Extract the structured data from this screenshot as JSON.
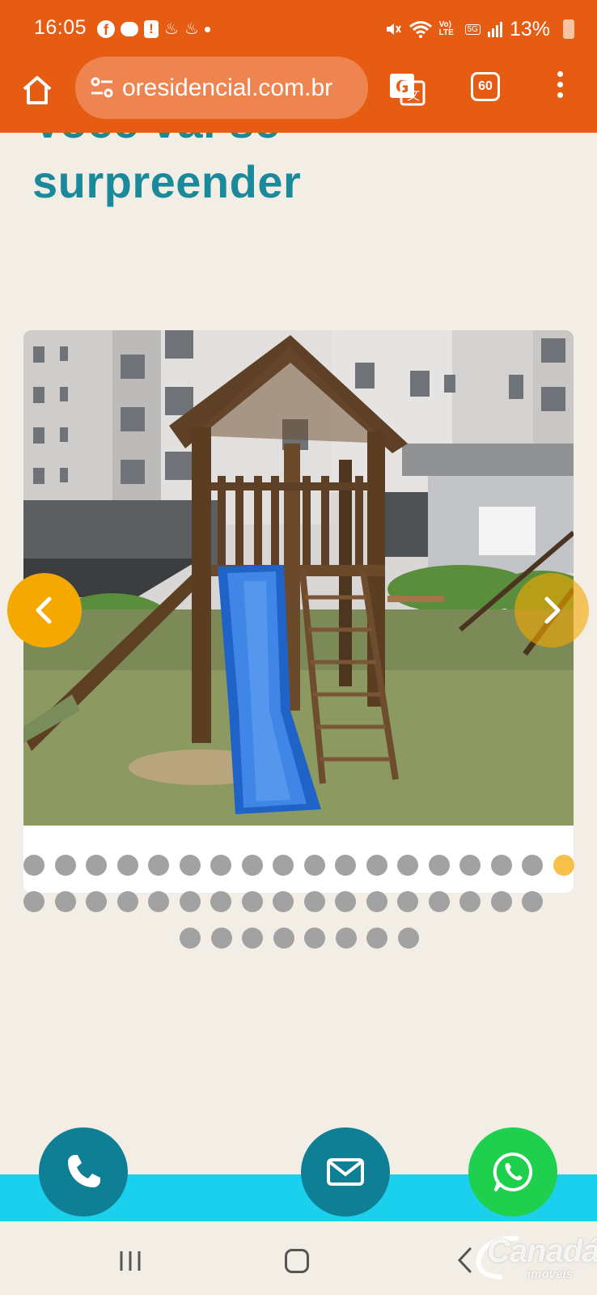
{
  "status_bar": {
    "time": "16:05",
    "battery": "13%",
    "network": "5G",
    "volte": "Vo) LTE",
    "notification_icons": [
      "facebook-icon",
      "messenger-icon",
      "alert-icon",
      "santander-icon",
      "santander-icon",
      "dot-icon"
    ],
    "system_icons": [
      "mute-icon",
      "wifi-icon",
      "volte-icon",
      "5g-icon",
      "signal-icon",
      "battery-icon"
    ]
  },
  "browser": {
    "url": "oresidencial.com.br",
    "tab_count": "60",
    "icons": [
      "home-icon",
      "site-settings-icon",
      "translate-icon",
      "tabs-icon",
      "menu-icon"
    ]
  },
  "page": {
    "heading_partial": "Você vai se",
    "heading": "surpreender"
  },
  "carousel": {
    "image_subject": "wooden playground with blue slide in front of apartment buildings",
    "total_slides": 43,
    "active_index": 17,
    "prev_icon": "chevron-left-icon",
    "next_icon": "chevron-right-icon"
  },
  "contact_buttons": [
    "phone-icon",
    "mail-icon",
    "whatsapp-icon"
  ],
  "watermark": {
    "name": "Canadá",
    "sub": "imóveis"
  },
  "colors": {
    "header_orange": "#e65c13",
    "heading_teal": "#1a8a9b",
    "arrow_gold": "#f5a800",
    "active_dot": "#f7c04a",
    "inactive_dot": "#a2a2a2",
    "cyan_band": "#1ad0ed",
    "fab_teal": "#0f7f96",
    "whatsapp_green": "#1fcf4e",
    "page_background": "#f2eee6"
  }
}
